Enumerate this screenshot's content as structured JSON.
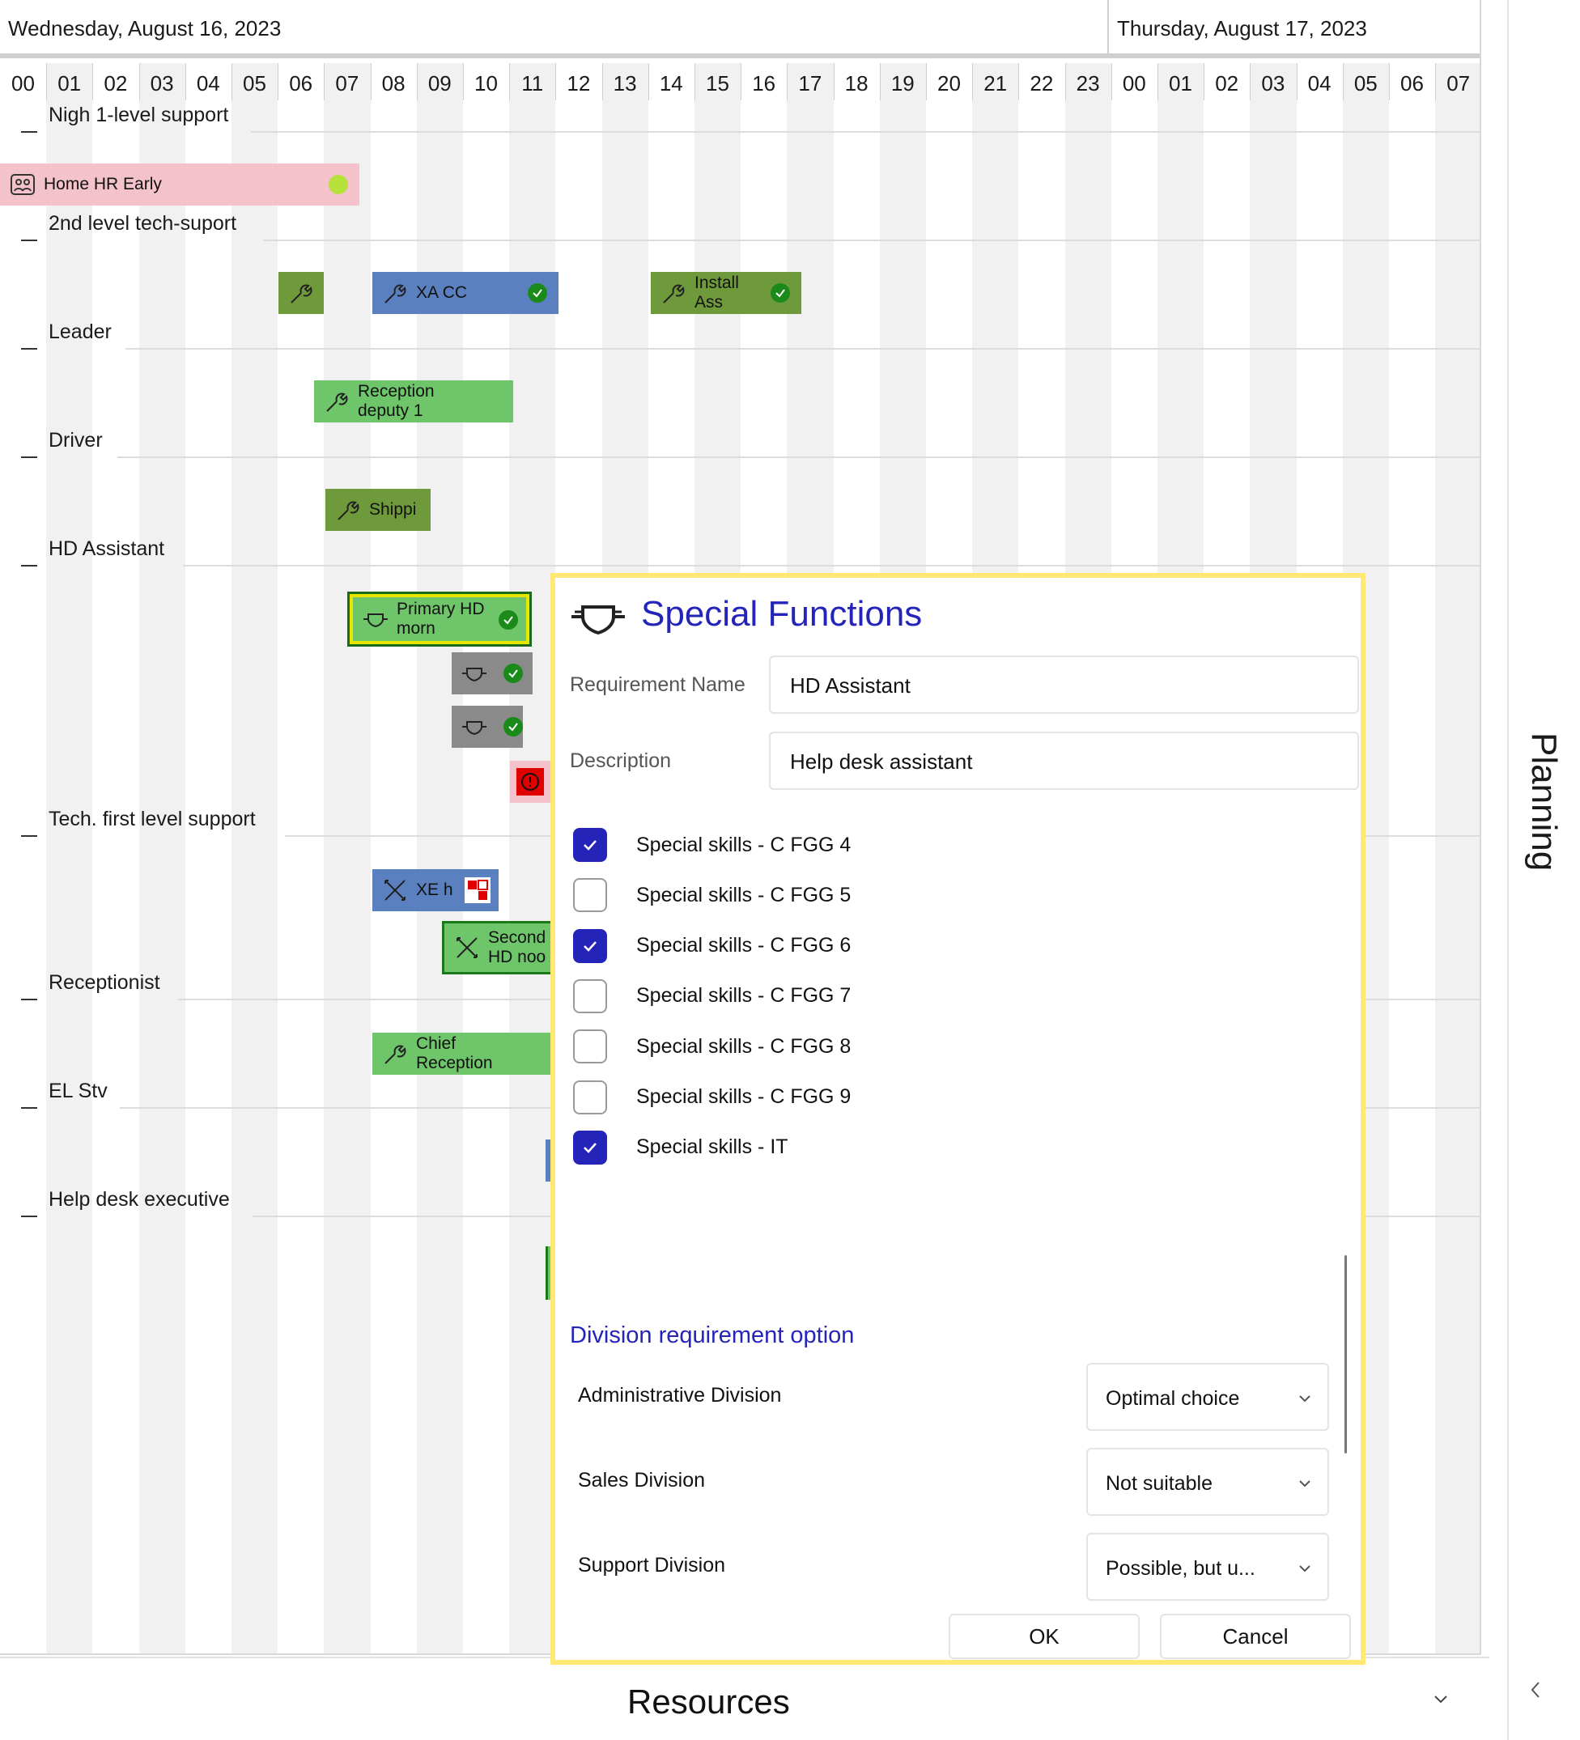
{
  "header": {
    "day1": "Wednesday, August 16, 2023",
    "day2": "Thursday, August 17, 2023"
  },
  "hours": [
    "00",
    "01",
    "02",
    "03",
    "04",
    "05",
    "06",
    "07",
    "08",
    "09",
    "10",
    "11",
    "12",
    "13",
    "14",
    "15",
    "16",
    "17",
    "18",
    "19",
    "20",
    "21",
    "22",
    "23",
    "00",
    "01",
    "02",
    "03",
    "04",
    "05",
    "06",
    "07"
  ],
  "rows": {
    "r1": "Nigh 1-level support",
    "r2": "2nd level tech-suport",
    "r3": "Leader",
    "r4": "Driver",
    "r5": "HD Assistant",
    "r6": "Tech. first level support",
    "r7": "Receptionist",
    "r8": "EL Stv",
    "r9": "Help desk executive"
  },
  "tasks": {
    "home_hr": "Home HR Early",
    "xa_cc": "XA CC",
    "install": "Install\nAss",
    "reception_deputy": "Reception\ndeputy 1",
    "shipping": "Shippi",
    "primary_hd": "Primary HD\nmorn",
    "xe": "XE h",
    "second_hd": "Second\nHD noo",
    "chief_reception": "Chief\nReception"
  },
  "side_panel": {
    "title": "Planning"
  },
  "resources": {
    "title": "Resources"
  },
  "dialog": {
    "title": "Special Functions",
    "requirement_name_label": "Requirement Name",
    "requirement_name_value": "HD Assistant",
    "description_label": "Description",
    "description_value": "Help desk assistant",
    "skills": [
      {
        "label": "Special skills - C FGG 4",
        "checked": true
      },
      {
        "label": "Special skills - C FGG 5",
        "checked": false
      },
      {
        "label": "Special skills - C FGG 6",
        "checked": true
      },
      {
        "label": "Special skills - C FGG 7",
        "checked": false
      },
      {
        "label": "Special skills - C FGG 8",
        "checked": false
      },
      {
        "label": "Special skills - C FGG 9",
        "checked": false
      },
      {
        "label": "Special skills - IT",
        "checked": true
      }
    ],
    "division_heading": "Division requirement option",
    "divisions": [
      {
        "label": "Administrative Division",
        "value": "Optimal choice"
      },
      {
        "label": "Sales Division",
        "value": "Not suitable"
      },
      {
        "label": "Support Division",
        "value": "Possible, but u..."
      }
    ],
    "ok_label": "OK",
    "cancel_label": "Cancel"
  },
  "colors": {
    "accent": "#2424b8",
    "dialog_border": "#ffe873",
    "olive": "#6f9a3b",
    "blue": "#5b80c0",
    "green": "#6fc56a",
    "pink": "#f4c2cb",
    "check_green": "#1a8a1a",
    "error_red": "#e00000"
  }
}
